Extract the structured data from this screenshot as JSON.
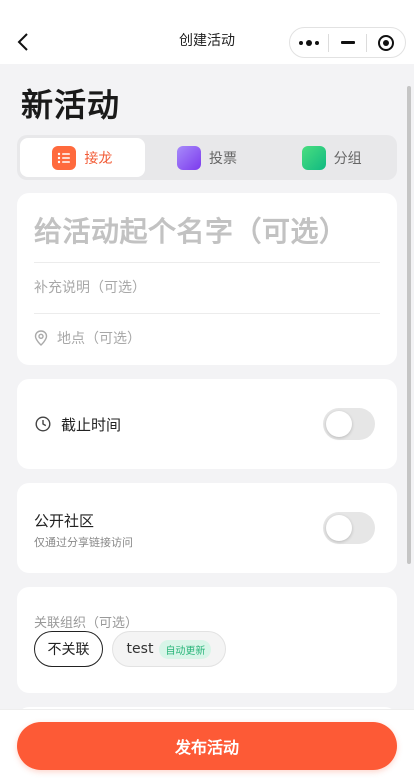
{
  "navbar": {
    "title": "创建活动",
    "back_icon": "chevron-left-icon",
    "capsule": [
      "more-dots-icon",
      "minimize-icon",
      "close-target-icon"
    ]
  },
  "page": {
    "title": "新活动"
  },
  "tabs": [
    {
      "label": "接龙",
      "icon": "list-icon",
      "icon_color": "#ff6a3d",
      "active": true
    },
    {
      "label": "投票",
      "icon": "vote-icon",
      "icon_color": "#8b5cf6",
      "active": false
    },
    {
      "label": "分组",
      "icon": "group-icon",
      "icon_color": "#22c55e",
      "active": false
    }
  ],
  "form": {
    "name_placeholder": "给活动起个名字（可选）",
    "desc_placeholder": "补充说明（可选）",
    "location_placeholder": "地点（可选）"
  },
  "deadline": {
    "label": "截止时间",
    "enabled": false
  },
  "public_community": {
    "label": "公开社区",
    "description": "仅通过分享链接访问",
    "enabled": false
  },
  "organization": {
    "label": "关联组织（可选）",
    "options": [
      {
        "label": "不关联",
        "selected": true
      },
      {
        "label": "test",
        "badge": "自动更新",
        "selected": false
      }
    ]
  },
  "footer": {
    "publish_label": "发布活动"
  },
  "colors": {
    "accent": "#fd5a36",
    "badge_green": "#2ab57a"
  }
}
